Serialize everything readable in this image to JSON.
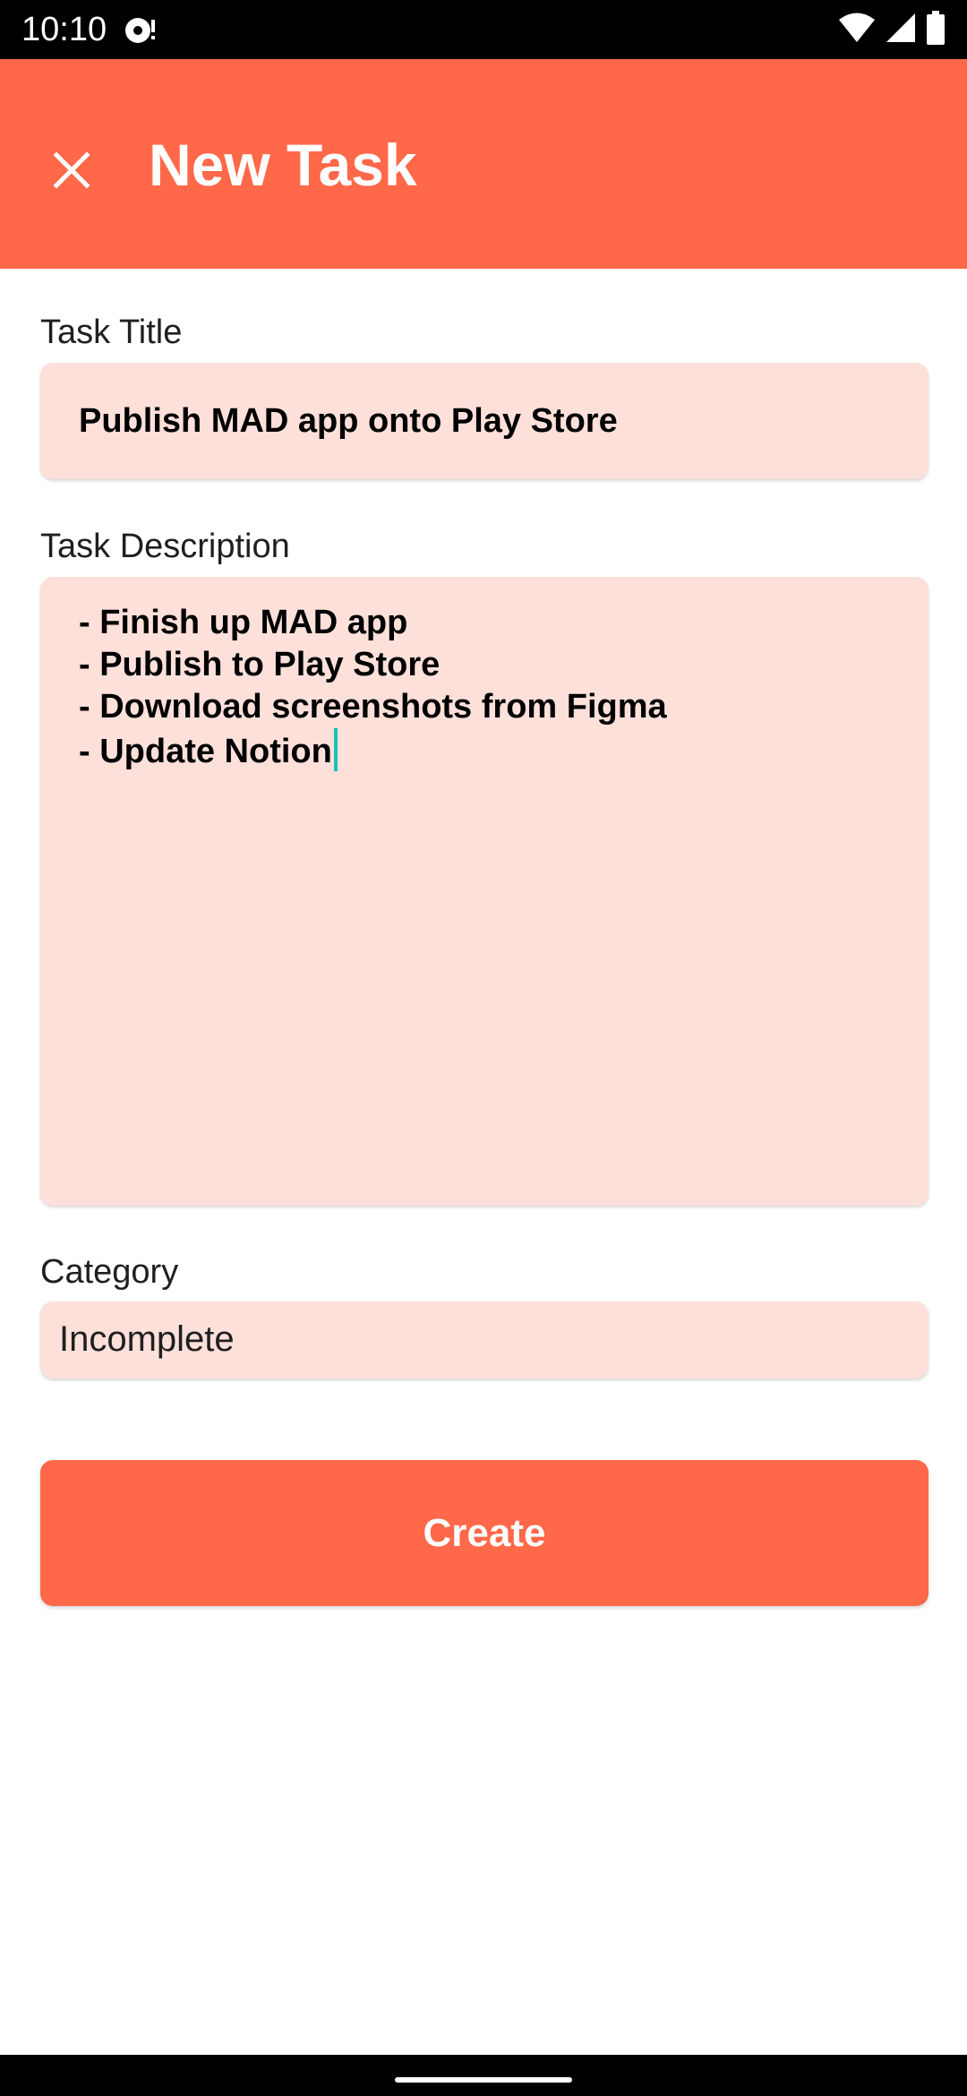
{
  "status_bar": {
    "time": "10:10",
    "icons": [
      "notification-icon",
      "wifi-icon",
      "signal-icon",
      "battery-icon"
    ]
  },
  "app_bar": {
    "title": "New Task",
    "close_icon": "close-icon",
    "background_color": "#FF6848"
  },
  "form": {
    "task_title": {
      "label": "Task Title",
      "value": "Publish MAD app onto Play Store"
    },
    "task_description": {
      "label": "Task Description",
      "lines": [
        "- Finish up MAD app",
        "- Publish to Play Store",
        "- Download screenshots from Figma",
        "- Update Notion"
      ]
    },
    "category": {
      "label": "Category",
      "value": "Incomplete"
    },
    "field_background_color": "#FDE0DA",
    "cursor_color": "#1CC2B2"
  },
  "actions": {
    "create_label": "Create",
    "create_color": "#FF6848"
  }
}
